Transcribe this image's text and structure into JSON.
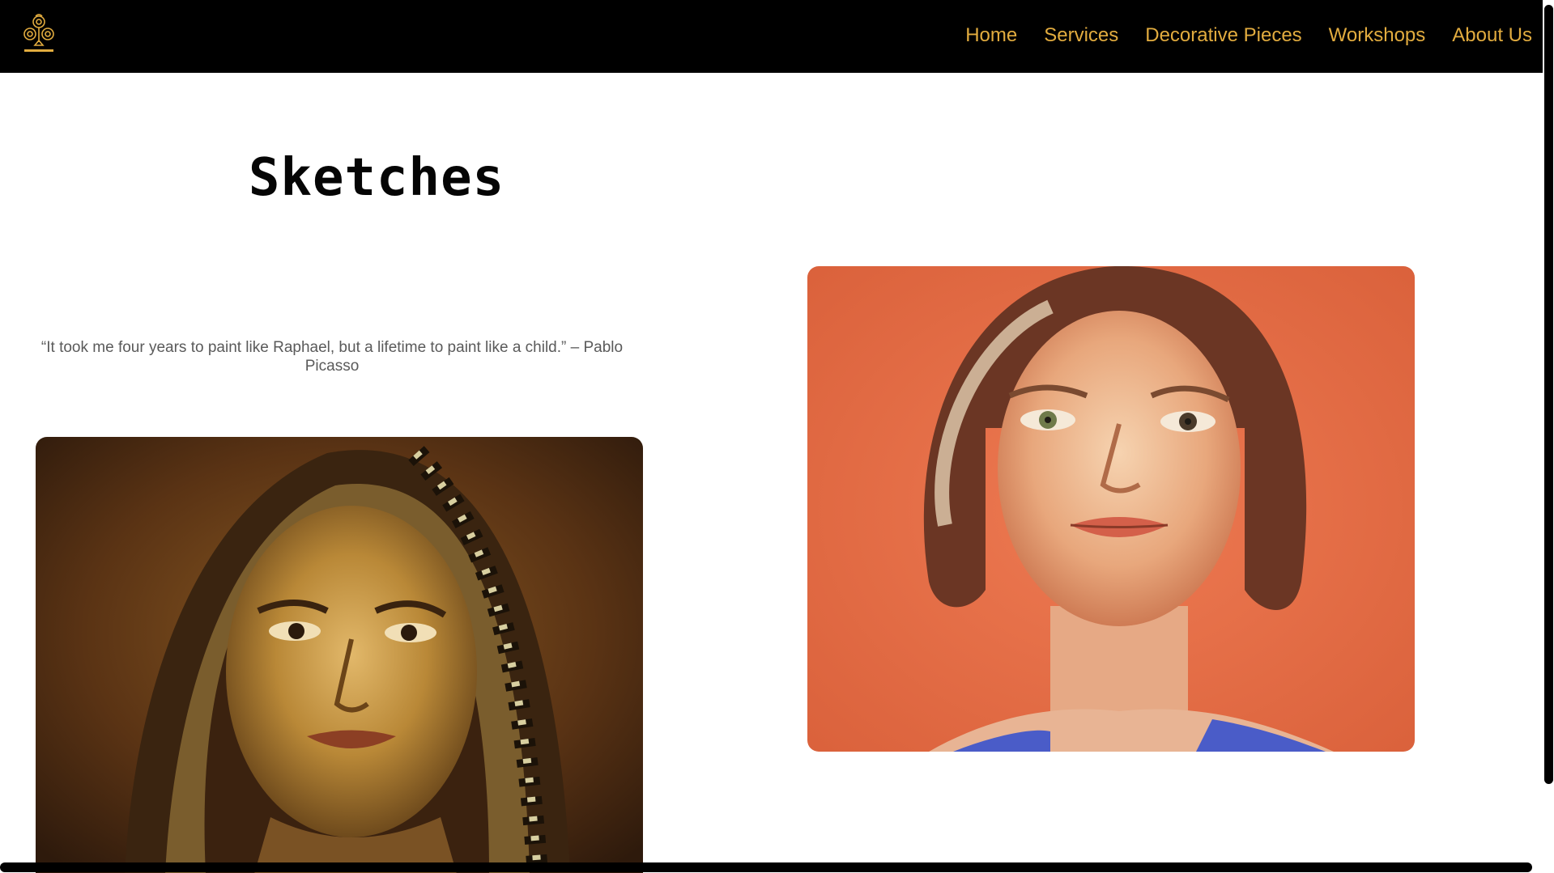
{
  "header": {
    "logo_icon": "club-ornament-logo-icon",
    "brand_color": "#e2ac3f",
    "nav": [
      {
        "label": "Home"
      },
      {
        "label": "Services"
      },
      {
        "label": "Decorative Pieces"
      },
      {
        "label": "Workshops"
      },
      {
        "label": "About Us"
      }
    ]
  },
  "main": {
    "title": "Sketches",
    "quote": "“It took me four years to paint like Raphael, but a lifetime to paint like a child.” – Pablo Picasso"
  },
  "artworks": [
    {
      "name": "veiled-woman-oil-painting",
      "palette": [
        "#4a2a12",
        "#c9963e",
        "#e8c27a",
        "#6b5a2a"
      ]
    },
    {
      "name": "pastel-portrait-orange-background",
      "palette": [
        "#e36b43",
        "#f2c7a3",
        "#6b3a25",
        "#4a5cc8"
      ]
    }
  ]
}
